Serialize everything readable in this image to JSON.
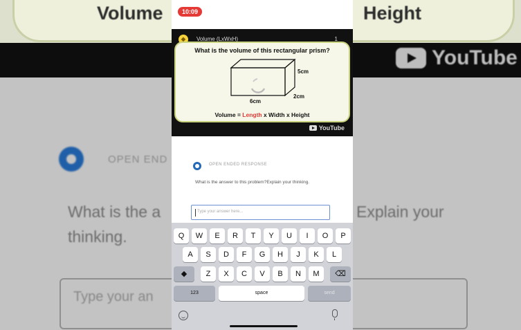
{
  "background": {
    "formula_left": "Volume",
    "formula_right": "Height",
    "youtube_label": "YouTube",
    "open_label": "OPEN END",
    "question_left_line1": "What is the a",
    "question_left_line2": "thinking.",
    "question_right": "Explain your",
    "input_placeholder": "Type your an"
  },
  "status": {
    "time": "10:09"
  },
  "video": {
    "title": "Volume (LxWxH)",
    "count": "1",
    "slide_question": "What is the volume of this rectangular prism?",
    "height_label": "5cm",
    "width_label": "2cm",
    "length_label": "6cm",
    "formula_start": "Volume = ",
    "formula_length": "Length",
    "formula_end": " x Width x Height",
    "youtube_label": "YouTube"
  },
  "response": {
    "type_label": "OPEN ENDED RESPONSE",
    "question": "What is the answer to this problem?Explain your thinking.",
    "answer_placeholder": "Type your answer here..."
  },
  "keyboard": {
    "row1": [
      "Q",
      "W",
      "E",
      "R",
      "T",
      "Y",
      "U",
      "I",
      "O",
      "P"
    ],
    "row2": [
      "A",
      "S",
      "D",
      "F",
      "G",
      "H",
      "J",
      "K",
      "L"
    ],
    "row3": [
      "Z",
      "X",
      "C",
      "V",
      "B",
      "N",
      "M"
    ],
    "numbers_key": "123",
    "space_key": "space",
    "send_key": "send"
  },
  "colors": {
    "accent_blue": "#2468b8",
    "time_pill": "#e53935",
    "slide_border": "#c9d27c"
  }
}
